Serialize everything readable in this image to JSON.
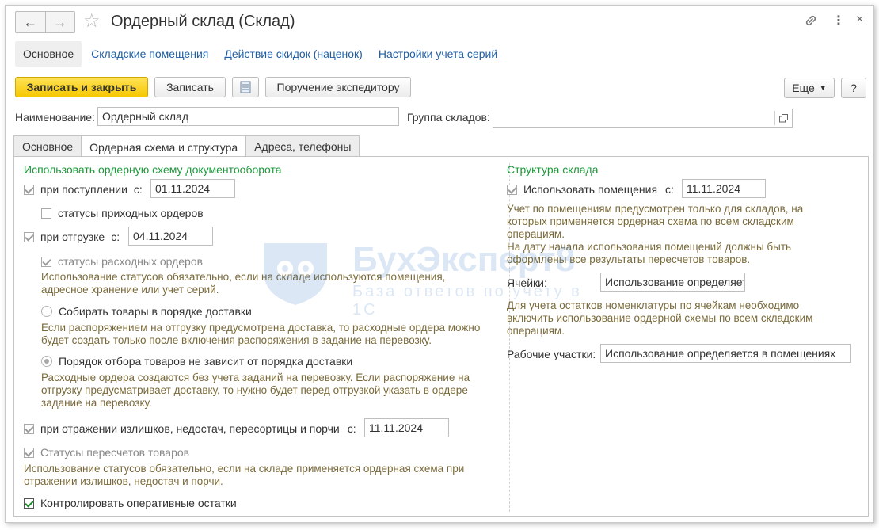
{
  "window": {
    "title": "Ордерный склад (Склад)",
    "nav_back": "←",
    "nav_forward": "→",
    "icons": {
      "link": "link-icon",
      "more": "more-vertical-icon",
      "close": "close-icon"
    }
  },
  "topnav": {
    "main": "Основное",
    "links": [
      "Складские помещения",
      "Действие скидок (наценок)",
      "Настройки учета серий"
    ]
  },
  "toolbar": {
    "save_close": "Записать и закрыть",
    "save": "Записать",
    "forwarder": "Поручение экспедитору",
    "more": "Еще",
    "help": "?"
  },
  "form": {
    "name_label": "Наименование:",
    "name_value": "Ордерный склад",
    "group_label": "Группа складов:",
    "group_value": ""
  },
  "tabs": [
    "Основное",
    "Ордерная схема и структура",
    "Адреса, телефоны"
  ],
  "left": {
    "heading": "Использовать ордерную схему документооборота",
    "receipt_label": "при поступлении",
    "receipt_from": "с:",
    "receipt_date": "01.11.2024",
    "incoming_statuses": "статусы приходных ордеров",
    "shipment_label": "при отгрузке",
    "shipment_from": "с:",
    "shipment_date": "04.11.2024",
    "outgoing_statuses": "статусы расходных ордеров",
    "note_statuses": [
      "Использование статусов обязательно, если на складе используются помещения,",
      "адресное хранение или учет серий."
    ],
    "radio1_label": "Собирать товары в порядке доставки",
    "radio1_note": [
      "Если распоряжением на отгрузку предусмотрена доставка, то расходные ордера можно",
      "будет создать только после включения распоряжения в задание на перевозку."
    ],
    "radio2_label": "Порядок отбора товаров не зависит от порядка доставки",
    "radio2_note": [
      "Расходные ордера создаются без учета заданий на перевозку. Если распоряжение на",
      "отгрузку предусматривает доставку, то нужно будет перед отгрузкой указать в ордере",
      "задание на перевозку."
    ],
    "surplus_label": "при отражении излишков, недостач, пересортицы и порчи",
    "surplus_from": "с:",
    "surplus_date": "11.11.2024",
    "recount_statuses": "Статусы пересчетов товаров",
    "recount_note": [
      "Использование статусов обязательно, если на складе применяется ордерная схема при",
      "отражении излишков, недостач и порчи."
    ],
    "control_label": "Контролировать оперативные остатки"
  },
  "right": {
    "heading": "Структура склада",
    "rooms_label": "Использовать помещения",
    "rooms_from": "с:",
    "rooms_date": "11.11.2024",
    "rooms_note": [
      "Учет по помещениям предусмотрен только для складов, на",
      "которых применяется ордерная схема по всем складским",
      "операциям.",
      "На дату начала использования помещений должны быть",
      "оформлены все результаты пересчетов товаров."
    ],
    "cells_label": "Ячейки:",
    "cells_value": "Использование определяет",
    "cells_note": [
      "Для учета остатков номенклатуры по ячейкам необходимо",
      "включить использование ордерной схемы по всем складским",
      "операциям."
    ],
    "work_label": "Рабочие участки:",
    "work_value": "Использование определяется в помещениях"
  },
  "watermark": {
    "brand": "БухЭксперт8",
    "tagline": "База ответов по учету в 1С"
  },
  "colors": {
    "accent_green": "#1a9a3a",
    "link_blue": "#1f5fa6",
    "primary_yellow": "#f5c800",
    "note_brown": "#7a6a3a"
  }
}
